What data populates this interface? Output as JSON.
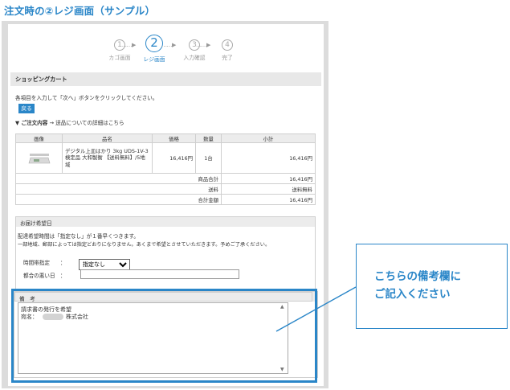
{
  "page_title": "注文時の②レジ画面（サンプル）",
  "stepper": {
    "steps": [
      {
        "number": "1",
        "label": "カゴ画面"
      },
      {
        "number": "2",
        "label": "レジ画面"
      },
      {
        "number": "3",
        "label": "入力確認"
      },
      {
        "number": "4",
        "label": "完了"
      }
    ],
    "arrow": "……▶"
  },
  "shopping_cart": {
    "heading": "ショッピングカート",
    "instruction": "各項目を入力して「次へ」ボタンをクリックしてください。",
    "back_button": "戻る",
    "order_contents_label": "▼ ご注文内容",
    "shipping_link": "→ 送品についての詳細はこちら",
    "columns": [
      "画像",
      "品名",
      "価格",
      "数量",
      "小計"
    ],
    "item": {
      "name": "デジタル上皿はかり 3kg UDS-1V-3 検定品 大和製衡 【送料無料】/5地域",
      "price": "16,416円",
      "quantity": "1台",
      "subtotal": "16,416円"
    },
    "totals": [
      {
        "label": "商品合計",
        "value": "16,416円"
      },
      {
        "label": "送料",
        "value": "送料無料"
      },
      {
        "label": "合計金額",
        "value": "16,416円"
      }
    ]
  },
  "delivery": {
    "heading": "お届け希望日",
    "note1": "配達希望時間は「指定なし」が１番早くつきます。",
    "note2": "一部地域、郵部によっては指定どおりになりません。あくまで希望とさせていただきます。予めご了承ください。",
    "time_label": "時間帯指定",
    "colon": "：",
    "time_value": "指定なし",
    "convenient_label": "都合の悪い日"
  },
  "remarks": {
    "heading": "備　考",
    "line1": "請求書の発行を希望",
    "line2_prefix": "宛名：",
    "line2_suffix": "株式会社"
  },
  "callout": {
    "line1": "こちらの備考欄に",
    "line2": "ご記入ください"
  },
  "colors": {
    "accent": "#2a86c8",
    "frame": "#dcdcdc"
  }
}
